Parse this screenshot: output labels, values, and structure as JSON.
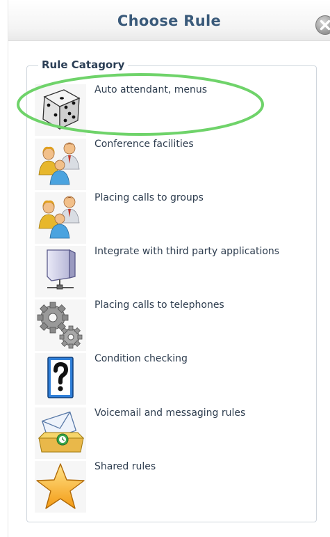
{
  "dialog": {
    "title": "Choose Rule",
    "close_icon": "close-circle-icon"
  },
  "rule_category": {
    "legend": "Rule Catagory",
    "items": [
      {
        "label": "Auto attendant, menus",
        "icon": "dice-icon",
        "highlighted": true
      },
      {
        "label": "Conference facilities",
        "icon": "people-icon"
      },
      {
        "label": "Placing calls to groups",
        "icon": "people-icon"
      },
      {
        "label": "Integrate with third party applications",
        "icon": "network-computer-icon"
      },
      {
        "label": "Placing calls to telephones",
        "icon": "gears-icon"
      },
      {
        "label": "Condition checking",
        "icon": "question-mark-icon"
      },
      {
        "label": "Voicemail and messaging rules",
        "icon": "envelope-inbox-icon"
      },
      {
        "label": "Shared rules",
        "icon": "star-icon"
      }
    ]
  },
  "colors": {
    "title": "#3a5a7a",
    "highlight": "#6fd36a",
    "label": "#2e3d4f"
  }
}
